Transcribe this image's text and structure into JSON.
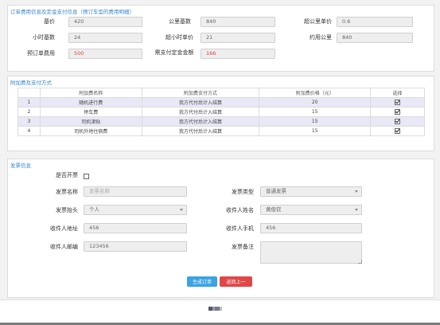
{
  "order_section": {
    "title": "订单费用信息及定金支付信息（预订车型的费用明细）",
    "fields": [
      {
        "label": "基价",
        "value": "420"
      },
      {
        "label": "公里基数",
        "value": "840"
      },
      {
        "label": "超公里单价",
        "value": "0.6"
      },
      {
        "label": "小时基数",
        "value": "24"
      },
      {
        "label": "超小时单价",
        "value": "21"
      },
      {
        "label": "约用公里",
        "value": "840"
      },
      {
        "label": "预订单费用",
        "value": "500"
      },
      {
        "label": "需支付定金金额",
        "value": "166"
      }
    ]
  },
  "fee_section": {
    "title": "附加费及支付方式",
    "columns": [
      "",
      "附加费名称",
      "附加费支付方式",
      "附加费价格（元）",
      "选择"
    ],
    "rows": [
      {
        "index": "1",
        "name": "随机进行费",
        "method": "我方代付后计入结算",
        "price": "20",
        "checked": true
      },
      {
        "index": "2",
        "name": "停车费",
        "method": "我方代付后计入结算",
        "price": "15",
        "checked": true
      },
      {
        "index": "3",
        "name": "司机津贴",
        "method": "我方代付后计入结算",
        "price": "15",
        "checked": true
      },
      {
        "index": "4",
        "name": "司机外地住宿费",
        "method": "我方代付后计入结算",
        "price": "15",
        "checked": true
      }
    ]
  },
  "invoice_section": {
    "title": "发票信息",
    "need_invoice_label": "是否开票",
    "invoice_name_label": "发票名称",
    "invoice_name_placeholder": "发票名称",
    "invoice_type_label": "发票类型",
    "invoice_type_value": "普通发票",
    "invoice_header_label": "发票抬头",
    "invoice_header_value": "个人",
    "recipient_name_label": "收件人姓名",
    "recipient_name_value": "黄俊钦",
    "recipient_address_label": "收件人地址",
    "recipient_address_value": "456",
    "recipient_phone_label": "收件人手机",
    "recipient_phone_value": "456",
    "recipient_zip_label": "收件人邮编",
    "recipient_zip_value": "123456",
    "remark_label": "发票备注",
    "remark_value": ""
  },
  "buttons": {
    "generate": "生成订单",
    "back": "返回上一步"
  },
  "colors": {
    "primary": "#3aa3e3",
    "danger": "#e04848",
    "section_title": "#3a87c8",
    "highlight_row": "#e8e8f6"
  }
}
